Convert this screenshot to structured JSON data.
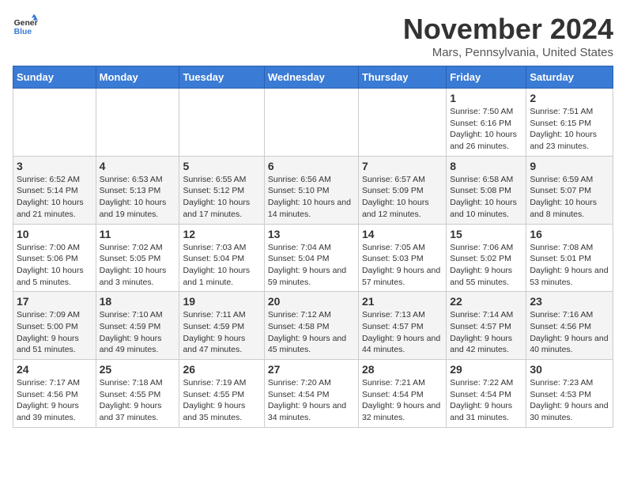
{
  "logo": {
    "line1": "General",
    "line2": "Blue"
  },
  "title": "November 2024",
  "subtitle": "Mars, Pennsylvania, United States",
  "days_of_week": [
    "Sunday",
    "Monday",
    "Tuesday",
    "Wednesday",
    "Thursday",
    "Friday",
    "Saturday"
  ],
  "weeks": [
    [
      {
        "day": "",
        "info": ""
      },
      {
        "day": "",
        "info": ""
      },
      {
        "day": "",
        "info": ""
      },
      {
        "day": "",
        "info": ""
      },
      {
        "day": "",
        "info": ""
      },
      {
        "day": "1",
        "info": "Sunrise: 7:50 AM\nSunset: 6:16 PM\nDaylight: 10 hours and 26 minutes."
      },
      {
        "day": "2",
        "info": "Sunrise: 7:51 AM\nSunset: 6:15 PM\nDaylight: 10 hours and 23 minutes."
      }
    ],
    [
      {
        "day": "3",
        "info": "Sunrise: 6:52 AM\nSunset: 5:14 PM\nDaylight: 10 hours and 21 minutes."
      },
      {
        "day": "4",
        "info": "Sunrise: 6:53 AM\nSunset: 5:13 PM\nDaylight: 10 hours and 19 minutes."
      },
      {
        "day": "5",
        "info": "Sunrise: 6:55 AM\nSunset: 5:12 PM\nDaylight: 10 hours and 17 minutes."
      },
      {
        "day": "6",
        "info": "Sunrise: 6:56 AM\nSunset: 5:10 PM\nDaylight: 10 hours and 14 minutes."
      },
      {
        "day": "7",
        "info": "Sunrise: 6:57 AM\nSunset: 5:09 PM\nDaylight: 10 hours and 12 minutes."
      },
      {
        "day": "8",
        "info": "Sunrise: 6:58 AM\nSunset: 5:08 PM\nDaylight: 10 hours and 10 minutes."
      },
      {
        "day": "9",
        "info": "Sunrise: 6:59 AM\nSunset: 5:07 PM\nDaylight: 10 hours and 8 minutes."
      }
    ],
    [
      {
        "day": "10",
        "info": "Sunrise: 7:00 AM\nSunset: 5:06 PM\nDaylight: 10 hours and 5 minutes."
      },
      {
        "day": "11",
        "info": "Sunrise: 7:02 AM\nSunset: 5:05 PM\nDaylight: 10 hours and 3 minutes."
      },
      {
        "day": "12",
        "info": "Sunrise: 7:03 AM\nSunset: 5:04 PM\nDaylight: 10 hours and 1 minute."
      },
      {
        "day": "13",
        "info": "Sunrise: 7:04 AM\nSunset: 5:04 PM\nDaylight: 9 hours and 59 minutes."
      },
      {
        "day": "14",
        "info": "Sunrise: 7:05 AM\nSunset: 5:03 PM\nDaylight: 9 hours and 57 minutes."
      },
      {
        "day": "15",
        "info": "Sunrise: 7:06 AM\nSunset: 5:02 PM\nDaylight: 9 hours and 55 minutes."
      },
      {
        "day": "16",
        "info": "Sunrise: 7:08 AM\nSunset: 5:01 PM\nDaylight: 9 hours and 53 minutes."
      }
    ],
    [
      {
        "day": "17",
        "info": "Sunrise: 7:09 AM\nSunset: 5:00 PM\nDaylight: 9 hours and 51 minutes."
      },
      {
        "day": "18",
        "info": "Sunrise: 7:10 AM\nSunset: 4:59 PM\nDaylight: 9 hours and 49 minutes."
      },
      {
        "day": "19",
        "info": "Sunrise: 7:11 AM\nSunset: 4:59 PM\nDaylight: 9 hours and 47 minutes."
      },
      {
        "day": "20",
        "info": "Sunrise: 7:12 AM\nSunset: 4:58 PM\nDaylight: 9 hours and 45 minutes."
      },
      {
        "day": "21",
        "info": "Sunrise: 7:13 AM\nSunset: 4:57 PM\nDaylight: 9 hours and 44 minutes."
      },
      {
        "day": "22",
        "info": "Sunrise: 7:14 AM\nSunset: 4:57 PM\nDaylight: 9 hours and 42 minutes."
      },
      {
        "day": "23",
        "info": "Sunrise: 7:16 AM\nSunset: 4:56 PM\nDaylight: 9 hours and 40 minutes."
      }
    ],
    [
      {
        "day": "24",
        "info": "Sunrise: 7:17 AM\nSunset: 4:56 PM\nDaylight: 9 hours and 39 minutes."
      },
      {
        "day": "25",
        "info": "Sunrise: 7:18 AM\nSunset: 4:55 PM\nDaylight: 9 hours and 37 minutes."
      },
      {
        "day": "26",
        "info": "Sunrise: 7:19 AM\nSunset: 4:55 PM\nDaylight: 9 hours and 35 minutes."
      },
      {
        "day": "27",
        "info": "Sunrise: 7:20 AM\nSunset: 4:54 PM\nDaylight: 9 hours and 34 minutes."
      },
      {
        "day": "28",
        "info": "Sunrise: 7:21 AM\nSunset: 4:54 PM\nDaylight: 9 hours and 32 minutes."
      },
      {
        "day": "29",
        "info": "Sunrise: 7:22 AM\nSunset: 4:54 PM\nDaylight: 9 hours and 31 minutes."
      },
      {
        "day": "30",
        "info": "Sunrise: 7:23 AM\nSunset: 4:53 PM\nDaylight: 9 hours and 30 minutes."
      }
    ]
  ]
}
